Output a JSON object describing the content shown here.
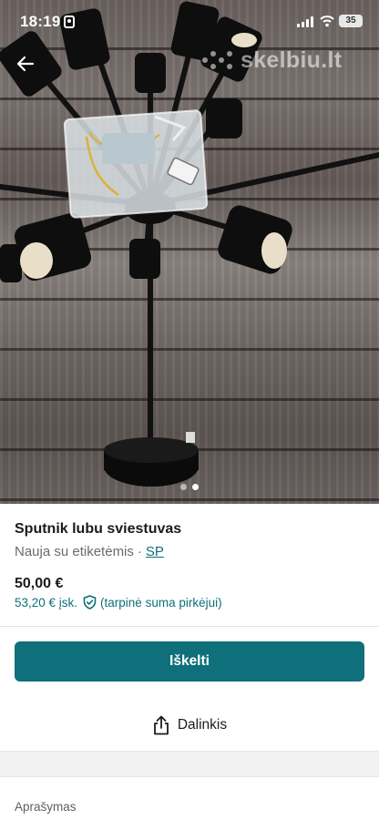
{
  "status_bar": {
    "time": "18:19",
    "battery": "35"
  },
  "photo": {
    "watermark": "skelbiu.lt",
    "page_count": 2,
    "current_page": 2
  },
  "listing": {
    "title": "Sputnik lubu sviestuvas",
    "condition": "Nauja su etiketėmis",
    "separator": "·",
    "size_link": "SP",
    "price": "50,00 €",
    "total_price": "53,20 € įsk.",
    "protection_note": "(tarpinė suma pirkėjui)"
  },
  "actions": {
    "bump_label": "Iškelti",
    "share_label": "Dalinkis"
  },
  "description": {
    "heading": "Aprašymas"
  },
  "colors": {
    "accent": "#0f6f7a",
    "text": "#1b1b1b",
    "muted": "#6b6b6b"
  },
  "icons": {
    "back": "arrow-left-icon",
    "share": "share-icon",
    "shield": "shield-check-icon"
  }
}
